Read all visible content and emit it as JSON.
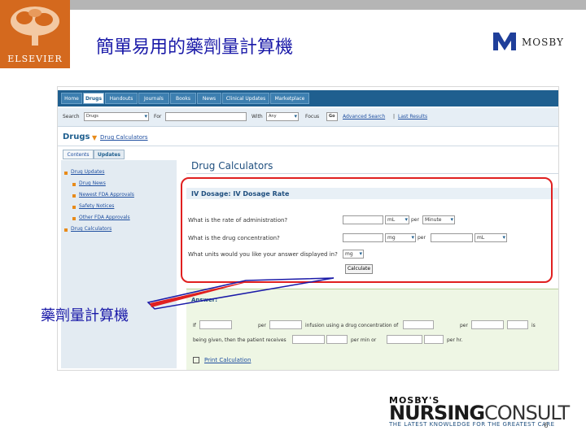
{
  "slide": {
    "title": "簡單易用的藥劑量計算機",
    "publisher_logo_text": "ELSEVIER",
    "mosby_logo_text": "MOSBY",
    "callout_label": "藥劑量計算機",
    "page_number": "6"
  },
  "nav": {
    "tabs": [
      "Home",
      "Drugs",
      "Handouts",
      "Journals",
      "Books",
      "News",
      "Clinical Updates",
      "Marketplace"
    ],
    "active_tab": "Drugs"
  },
  "search": {
    "search_label": "Search",
    "search_select": "Drugs",
    "for_label": "For",
    "with_label": "With",
    "with_select": "Any",
    "focus_label": "Focus",
    "go_label": "Go",
    "advanced_link": "Advanced Search",
    "separator": "|",
    "last_results_link": "Last Results"
  },
  "breadcrumb": {
    "section": "Drugs",
    "arrow": "▼",
    "current": "Drug Calculators"
  },
  "left_panel": {
    "tabs": [
      "Contents",
      "Updates"
    ],
    "items": [
      {
        "label": "Drug Updates",
        "level": 1
      },
      {
        "label": "Drug News",
        "level": 2
      },
      {
        "label": "Newest FDA Approvals",
        "level": 2
      },
      {
        "label": "Safety Notices",
        "level": 2
      },
      {
        "label": "Other FDA Approvals",
        "level": 2
      },
      {
        "label": "Drug Calculators",
        "level": 1
      }
    ]
  },
  "calculator": {
    "title": "Drug Calculators",
    "section_title": "IV Dosage: IV Dosage Rate",
    "q1": "What is the rate of administration?",
    "q1_unit": "mL",
    "q1_per": "per",
    "q1_time": "Minute",
    "q2": "What is the drug concentration?",
    "q2_unit": "mg",
    "q2_per": "per",
    "q2_vol_unit": "mL",
    "q3": "What units would you like your answer displayed in?",
    "q3_unit": "mg",
    "button": "Calculate"
  },
  "answer": {
    "title": "Answer:",
    "t1": "If",
    "t2": "per",
    "t3": "infusion using a drug concentration of",
    "t4": "per",
    "t5": "is",
    "t6": "being given, then the patient receives",
    "t7": "per min or",
    "t8": "per hr.",
    "print_link": "Print Calculation"
  },
  "brand": {
    "line1": "MOSBY'S",
    "nursing": "NURSING",
    "consult": "CONSULT",
    "tagline": "THE LATEST KNOWLEDGE FOR THE GREATEST CARE"
  },
  "colors": {
    "elsevier_orange": "#d4691e",
    "title_blue": "#1a1aa8",
    "highlight_red": "#e02020",
    "nav_blue": "#1f5f8f"
  }
}
